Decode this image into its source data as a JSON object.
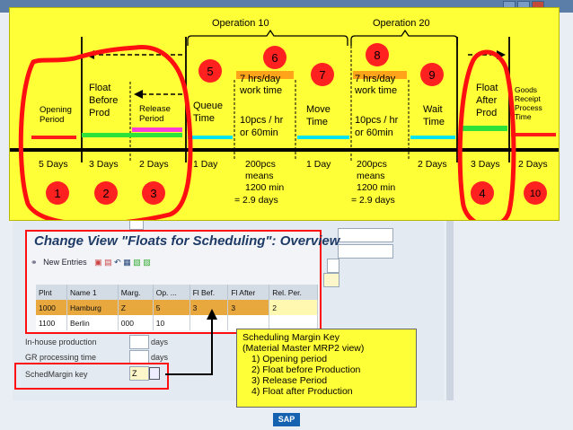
{
  "operations": {
    "op10": "Operation 10",
    "op20": "Operation 20"
  },
  "phases": [
    {
      "label": "Opening Period",
      "days": "5 Days",
      "circle": "1"
    },
    {
      "label": "Float Before Prod",
      "days": "3 Days",
      "circle": "2"
    },
    {
      "label": "Release Period",
      "days": "2 Days",
      "circle": "3"
    },
    {
      "label": "Queue Time",
      "days": "1 Day",
      "circle": "5"
    },
    {
      "label": "7 hrs/day work time",
      "sub": "10pcs / hr or 60min",
      "days": "200pcs means 1200 min = 2.9 days",
      "circle": "6"
    },
    {
      "label": "Move Time",
      "days": "1 Day",
      "circle": "7"
    },
    {
      "label": "7 hrs/day work time",
      "sub": "10pcs / hr or 60min",
      "days": "200pcs means 1200 min = 2.9 days",
      "circle": "8"
    },
    {
      "label": "Wait Time",
      "days": "2 Days",
      "circle": "9"
    },
    {
      "label": "Float After Prod",
      "days": "3 Days",
      "circle": "4"
    },
    {
      "label": "Goods Receipt Process Time",
      "days": "2 Days",
      "circle": "10"
    }
  ],
  "change_view": {
    "title": "Change View \"Floats for Scheduling\": Overview",
    "new_entries": "New Entries",
    "columns": [
      "Plnt",
      "Name 1",
      "Marg.",
      "Op. ...",
      "Fl Bef.",
      "Fl After",
      "Rel. Per."
    ],
    "rows": [
      [
        "1000",
        "Hamburg",
        "Z",
        "5",
        "3",
        "3",
        "2"
      ],
      [
        "1100",
        "Berlin",
        "000",
        "10",
        "",
        "",
        ""
      ]
    ]
  },
  "mrp_fields": {
    "inhouse_label": "In-house production",
    "inhouse_unit": "days",
    "gr_label": "GR processing time",
    "gr_unit": "days",
    "sched_label": "SchedMargin key",
    "sched_value": "Z"
  },
  "legend": {
    "title_1": "Scheduling Margin Key",
    "title_2": "(Material Master MRP2 view)",
    "items": [
      "1)      Opening period",
      "2)      Float before Production",
      "3)      Release Period",
      "4)      Float after Production"
    ]
  },
  "logo": "SAP",
  "colors": {
    "diagram_bg": "#ffff38",
    "circle_red": "#ff2020",
    "float_green": "#2fe23a",
    "release_magenta": "#ff3bd7",
    "cyan": "#00e5f0",
    "orange": "#ffa31a",
    "line_red": "#ff1a1a"
  }
}
